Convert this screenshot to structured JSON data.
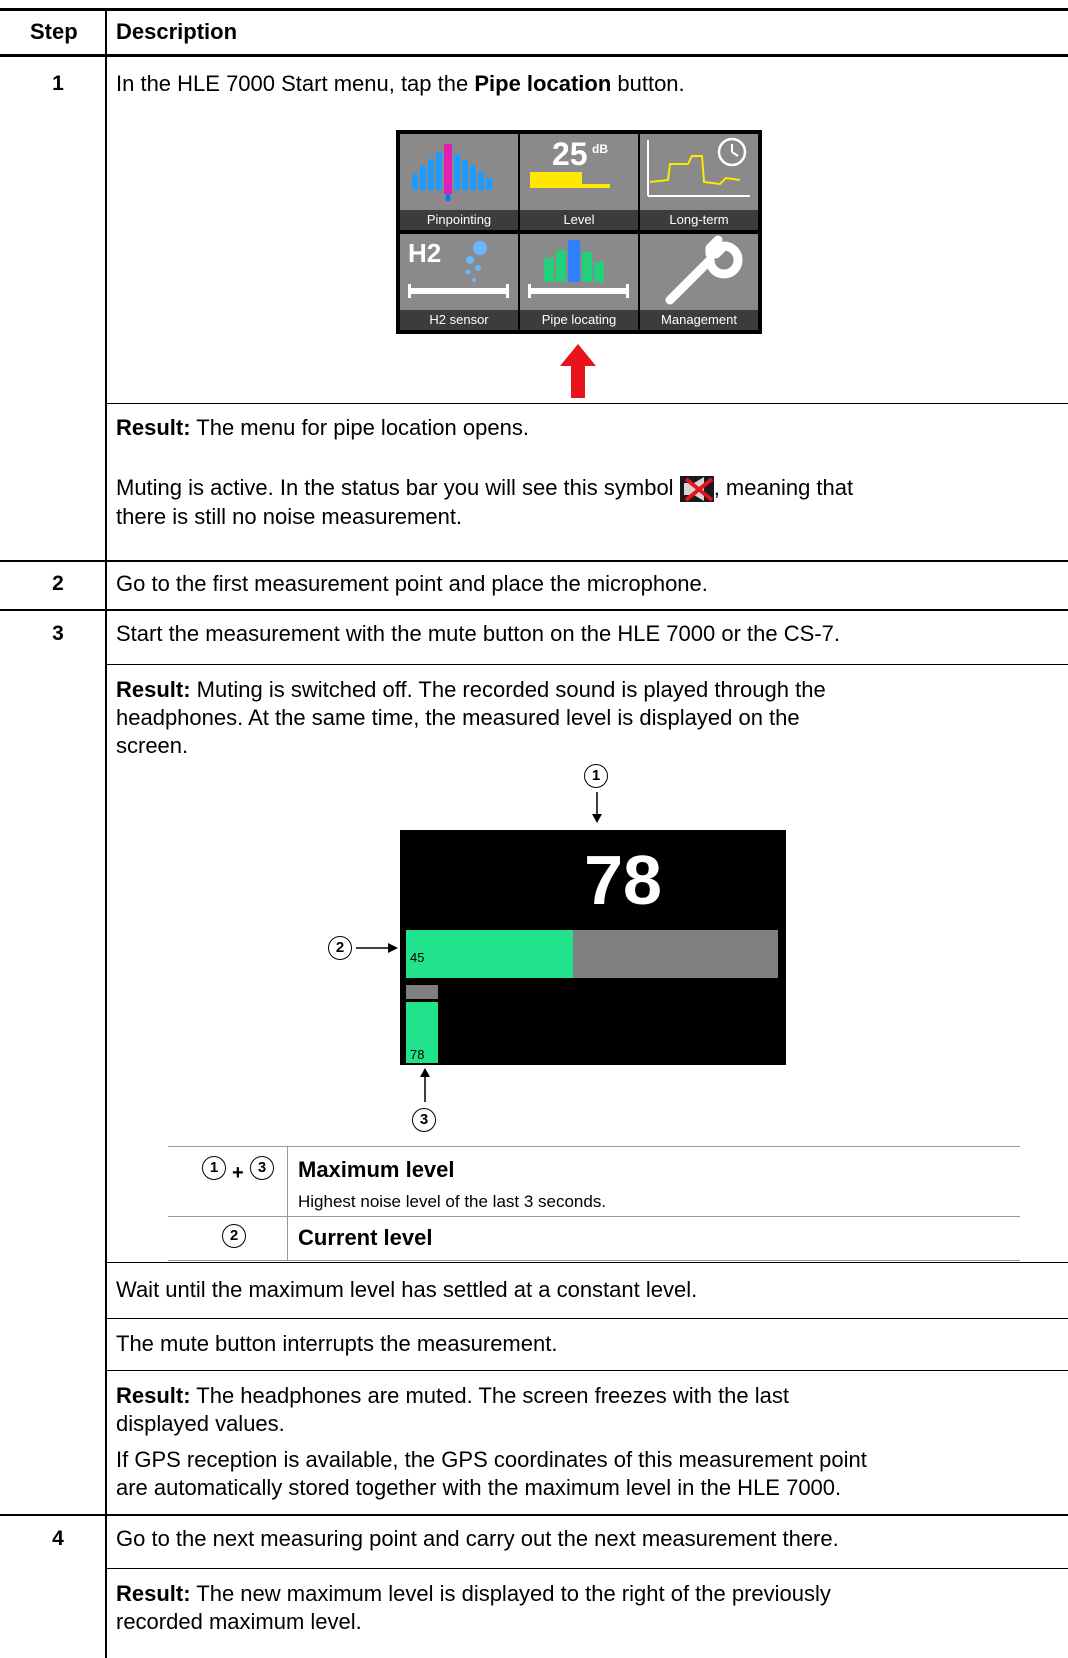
{
  "header": {
    "step": "Step",
    "description": "Description"
  },
  "steps": [
    {
      "num": "1",
      "text_prefix": "In the HLE 7000 Start menu, tap the ",
      "text_bold": "Pipe location",
      "text_suffix": " button.",
      "menu_tiles": [
        "Pinpointing",
        "Level",
        "Long-term",
        "H2 sensor",
        "Pipe locating",
        "Management"
      ],
      "level_tile_value": "25",
      "level_tile_unit": "dB",
      "h2_label": "H2",
      "result_label": "Result:",
      "result_text": " The menu for pipe location opens.",
      "mute_text_1": "Muting is active. In the status bar you will see this symbol ",
      "mute_text_2": ", meaning that",
      "mute_text_3": "there is still no noise measurement."
    },
    {
      "num": "2",
      "text": "Go to the first measurement point and place the microphone."
    },
    {
      "num": "3",
      "text": "Start the measurement with the mute button on the HLE 7000 or the CS-7.",
      "result_label": "Result:",
      "result_line1": " Muting is switched off. The recorded sound is played through the",
      "result_line2": "headphones. At the same time, the measured level is displayed on the",
      "result_line3": "screen.",
      "display": {
        "max_value": "78",
        "current_value": "45",
        "current_fraction": 0.45,
        "bar_value": "78"
      },
      "callouts": [
        "1",
        "2",
        "3"
      ],
      "legend": [
        {
          "key_a": "1",
          "plus": "+",
          "key_b": "3",
          "title": "Maximum level",
          "desc": "Highest noise level of the last 3 seconds."
        },
        {
          "key_a": "2",
          "title": "Current level"
        }
      ],
      "wait_text": "Wait until the maximum level has settled at a constant level.",
      "mute_interrupt": "The mute button interrupts the measurement.",
      "result2_label": "Result:",
      "result2_line1": " The headphones are muted. The screen freezes with the last",
      "result2_line2": "displayed values.",
      "gps_line1": "If GPS reception is available, the GPS coordinates of this measurement point",
      "gps_line2": "are automatically stored together with the maximum level in the HLE 7000."
    },
    {
      "num": "4",
      "text": "Go to the next measuring point and carry out the next measurement there.",
      "result_label": "Result:",
      "result_line1": " The new maximum level is displayed to the right of the previously",
      "result_line2": "recorded maximum level."
    }
  ],
  "colors": {
    "accent_green": "#22e38c",
    "arrow_red": "#e8141b",
    "tile_gray": "#8a8a8a"
  },
  "icons": [
    "mute-icon",
    "red-up-arrow"
  ]
}
